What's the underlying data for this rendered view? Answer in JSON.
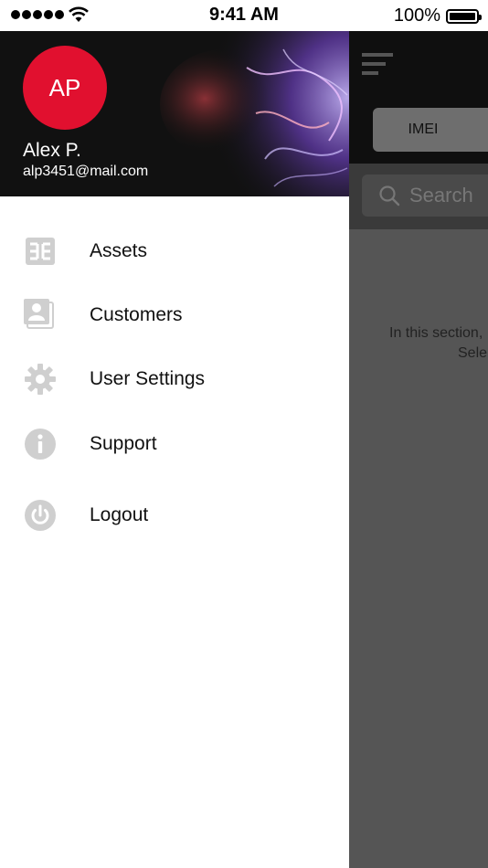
{
  "status_bar": {
    "time": "9:41 AM",
    "battery_percent": "100%",
    "signal_bars": 5
  },
  "drawer": {
    "avatar_initials": "AP",
    "user_name": "Alex P.",
    "user_email": "alp3451@mail.com",
    "accent_color": "#e1102f",
    "menu": [
      {
        "label": "Assets",
        "icon": "assets-icon"
      },
      {
        "label": "Customers",
        "icon": "contacts-icon"
      },
      {
        "label": "User Settings",
        "icon": "gear-icon"
      },
      {
        "label": "Support",
        "icon": "info-icon"
      },
      {
        "label": "Logout",
        "icon": "power-icon"
      }
    ]
  },
  "background_app": {
    "tab_label": "IMEI",
    "search_placeholder": "Search",
    "info_line1": "In this section,",
    "info_line2": "Sele"
  }
}
